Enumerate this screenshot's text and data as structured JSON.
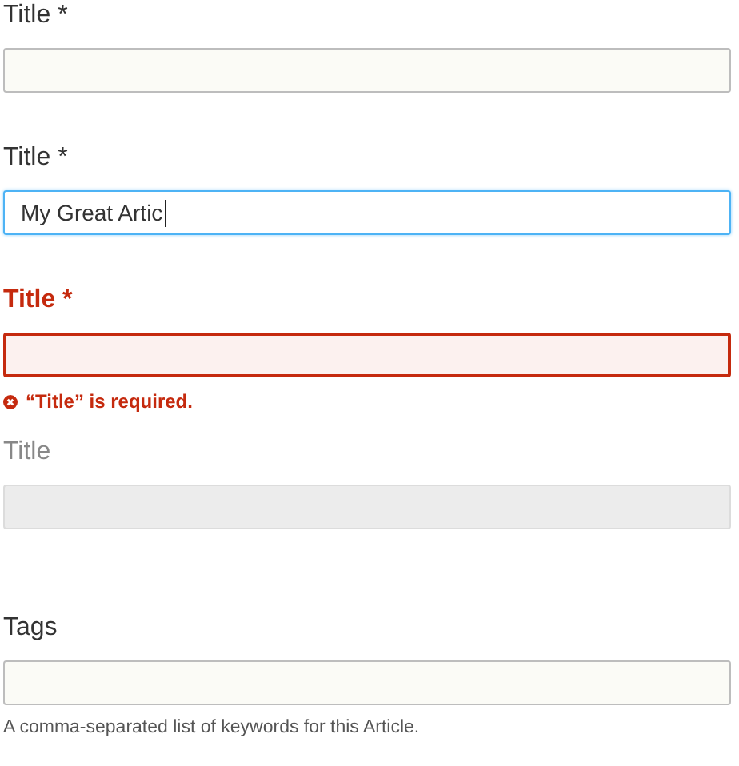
{
  "fields": [
    {
      "label": "Title *",
      "focused": false,
      "invalid": false,
      "disabled": false
    },
    {
      "label": "Title *",
      "focused": true,
      "invalid": false,
      "disabled": false,
      "value": "My Great Artic"
    },
    {
      "label": "Title *",
      "focused": false,
      "invalid": true,
      "disabled": false,
      "error": "“Title” is required."
    },
    {
      "label": "Title",
      "focused": false,
      "invalid": false,
      "disabled": true
    },
    {
      "label": "Tags",
      "focused": false,
      "invalid": false,
      "disabled": false,
      "help": "A comma-separated list of keywords for this Article."
    }
  ]
}
